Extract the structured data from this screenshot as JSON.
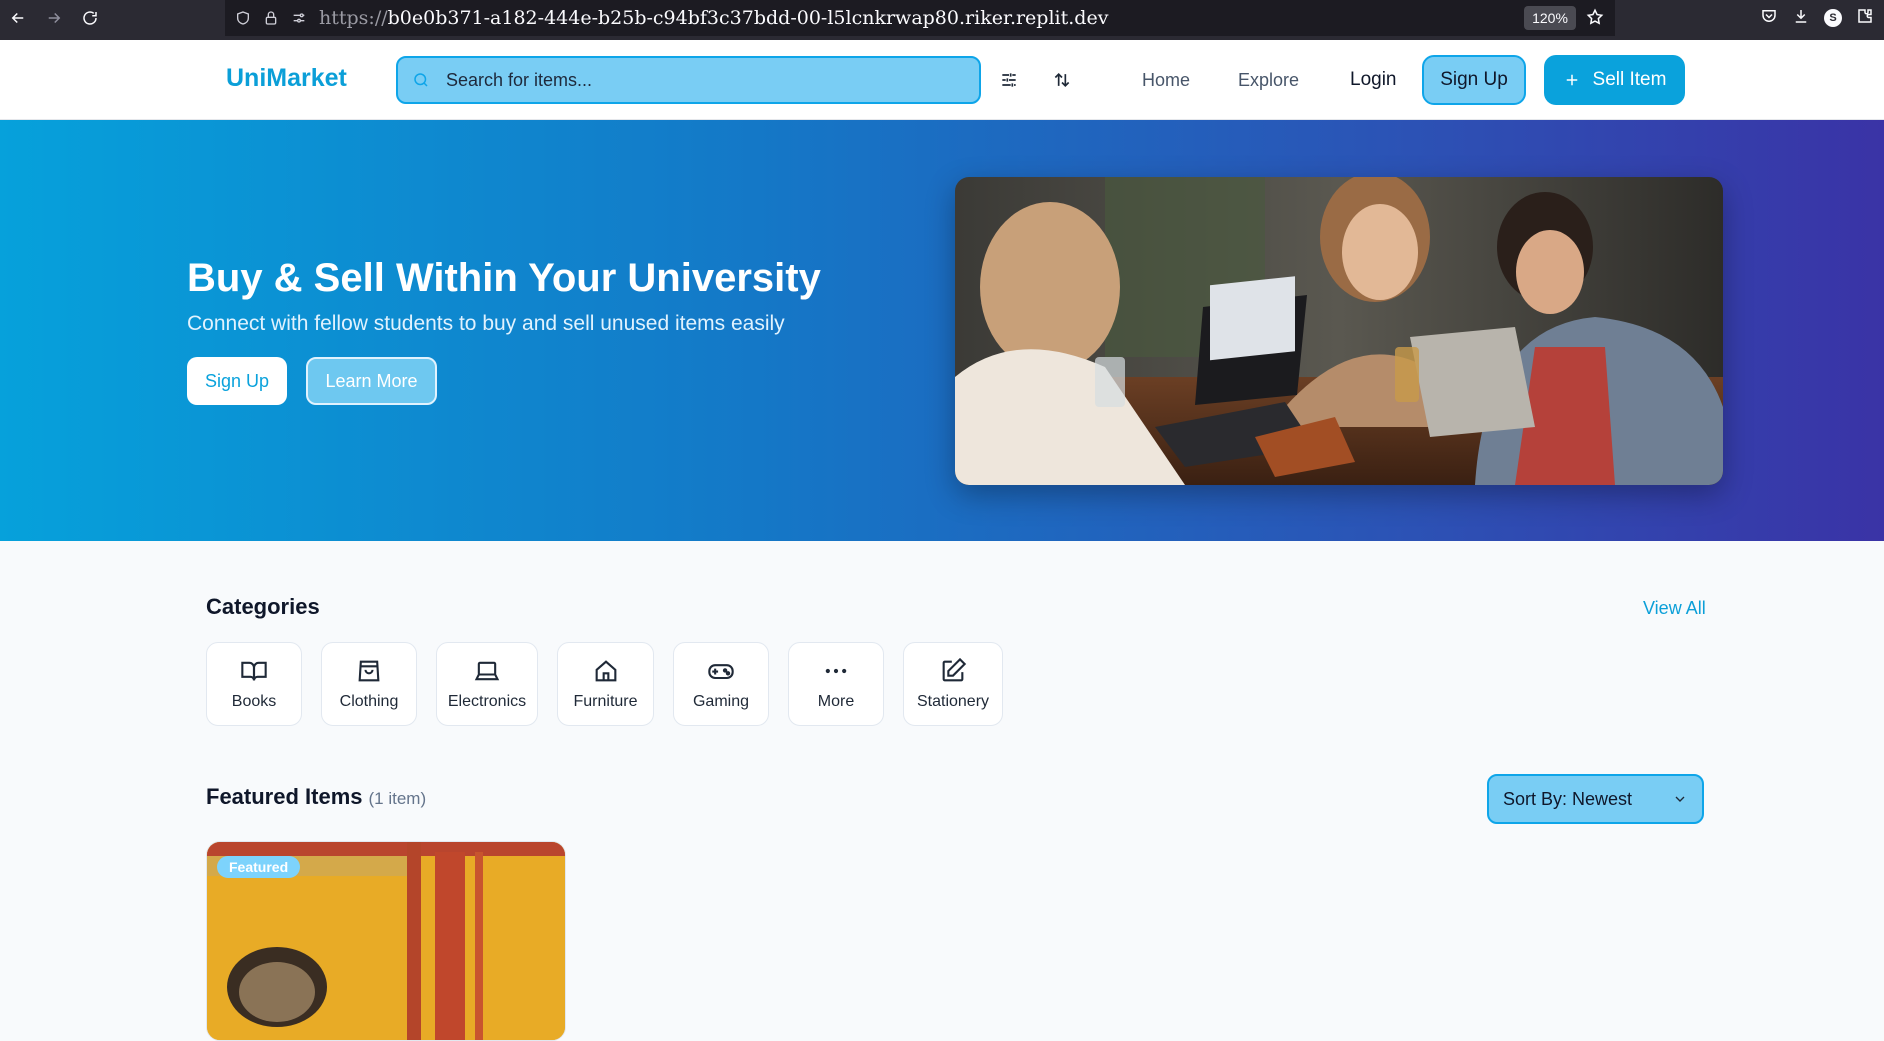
{
  "browser": {
    "url_scheme": "https://",
    "url_host": "b0e0b371-a182-444e-b25b-c94bf3c37bdd-00-l5lcnkrwap80.riker.replit.dev",
    "zoom": "120%",
    "profile_initial": "S"
  },
  "header": {
    "logo": "UniMarket",
    "search_placeholder": "Search for items...",
    "nav": {
      "home": "Home",
      "explore": "Explore"
    },
    "login": "Login",
    "signup": "Sign Up",
    "sell": "Sell Item"
  },
  "hero": {
    "title": "Buy & Sell Within Your University",
    "subtitle": "Connect with fellow students to buy and sell unused items easily",
    "signup": "Sign Up",
    "learn_more": "Learn More"
  },
  "categories": {
    "title": "Categories",
    "view_all": "View All",
    "items": [
      {
        "label": "Books",
        "icon": "book-icon"
      },
      {
        "label": "Clothing",
        "icon": "shopping-bag-icon"
      },
      {
        "label": "Electronics",
        "icon": "laptop-icon"
      },
      {
        "label": "Furniture",
        "icon": "home-icon"
      },
      {
        "label": "Gaming",
        "icon": "gamepad-icon"
      },
      {
        "label": "More",
        "icon": "more-dots-icon"
      },
      {
        "label": "Stationery",
        "icon": "pencil-edit-icon"
      }
    ]
  },
  "featured": {
    "title": "Featured Items",
    "count": "(1 item)",
    "sort": "Sort By: Newest",
    "badge": "Featured"
  },
  "colors": {
    "accent": "#0ea5e9",
    "accent_light": "#79cdf4",
    "hero_start": "#06a1db",
    "hero_end": "#3a33a6"
  }
}
